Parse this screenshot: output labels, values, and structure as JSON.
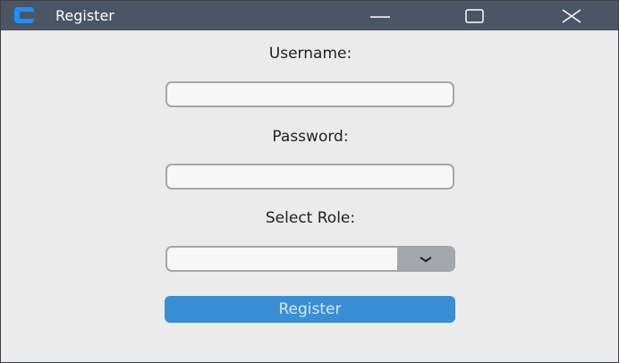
{
  "window": {
    "title": "Register",
    "app_icon": "app-logo-icon",
    "controls": {
      "minimize_icon": "minimize-icon",
      "maximize_icon": "maximize-icon",
      "close_icon": "close-icon"
    },
    "titlebar_color": "#4a5565"
  },
  "form": {
    "username_label": "Username:",
    "username_value": "",
    "password_label": "Password:",
    "password_value": "",
    "role_label": "Select Role:",
    "role_selected": "",
    "role_dropdown_icon": "chevron-down-icon",
    "submit_label": "Register",
    "accent_color": "#3a8fd4"
  }
}
